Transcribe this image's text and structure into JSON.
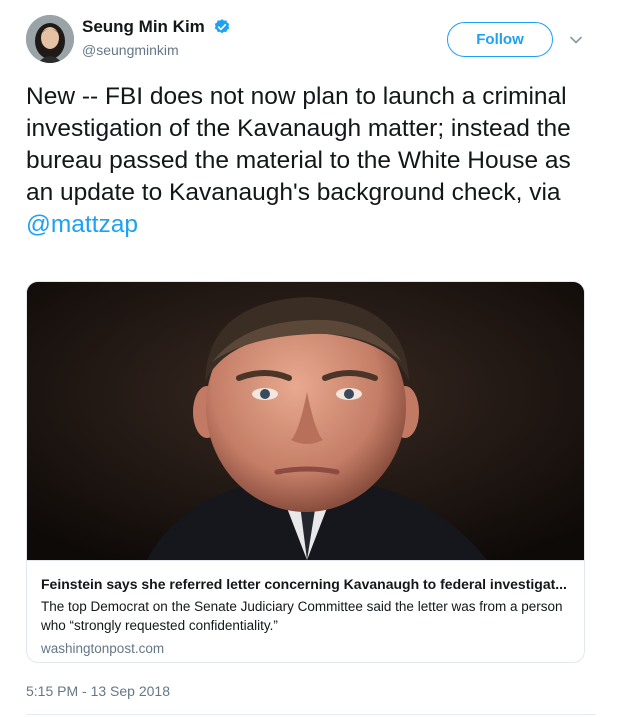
{
  "author": {
    "display_name": "Seung Min Kim",
    "handle": "@seungminkim",
    "verified": true,
    "verified_icon": "verified-badge-icon",
    "avatar_icon": "profile-avatar"
  },
  "actions": {
    "follow_label": "Follow",
    "menu_icon": "chevron-down-icon"
  },
  "tweet": {
    "text": "New -- FBI does not now plan to launch a criminal investigation of the Kavanaugh matter; instead the bureau passed the material to the White House as an update to Kavanaugh's background check, via ",
    "mention": "@mattzap",
    "timestamp": "5:15 PM - 13 Sep 2018"
  },
  "link_card": {
    "image": "photo of man in suit",
    "title": "Feinstein says she referred letter concerning Kavanaugh to federal investigat...",
    "description": "The top Democrat on the Senate Judiciary Committee said the letter was from a person who “strongly requested confidentiality.”",
    "domain": "washingtonpost.com"
  },
  "colors": {
    "accent": "#1da1f2",
    "text": "#14171a",
    "secondary_text": "#657786",
    "border": "#e1e8ed"
  }
}
